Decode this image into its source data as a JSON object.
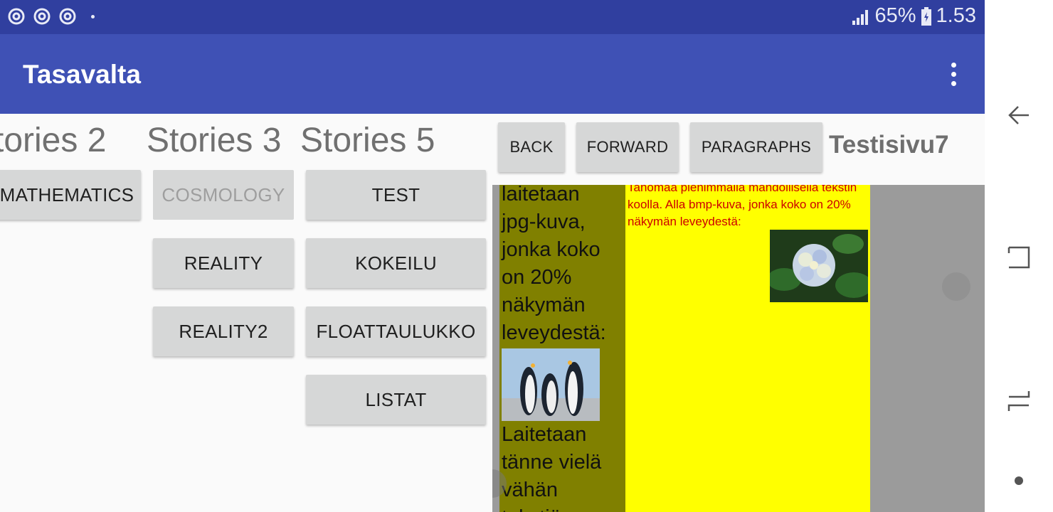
{
  "status_bar": {
    "battery": "65%",
    "time": "1.53",
    "icons": [
      "sync-icon",
      "sync-icon",
      "sync-icon",
      "dot-icon",
      "signal-icon",
      "battery-icon"
    ]
  },
  "app_bar": {
    "title": "Tasavalta",
    "menu_icon": "more-vert-icon"
  },
  "stories": {
    "titles": [
      "tories 2",
      "Stories 3",
      "Stories 5"
    ],
    "col1_buttons": [
      "MATHEMATICS"
    ],
    "col2_buttons": [
      "COSMOLOGY",
      "REALITY",
      "REALITY2"
    ],
    "col3_buttons": [
      "TEST",
      "KOKEILU",
      "FLOATTAULUKKO",
      "LISTAT"
    ]
  },
  "browser": {
    "back_label": "BACK",
    "forward_label": "FORWARD",
    "paragraphs_label": "PARAGRAPHS",
    "page_title": "Testisivu7"
  },
  "web_content": {
    "col1_lines_a": [
      "laitetaan",
      "jpg-kuva,",
      "jonka koko",
      "on 20%",
      "näkymän",
      "leveydestä:"
    ],
    "col1_lines_b": [
      "Laitetaan",
      "tänne vielä",
      "vähän",
      "tekstiä"
    ],
    "col2_text": "Tahomaa pienimmällä mahdollisella tekstin koolla. Alla bmp-kuva, jonka koko on 20% näkymän leveydestä:",
    "col1_image": "penguins-image",
    "col2_image": "hydrangea-image",
    "colors": {
      "col1_bg": "#808000",
      "col2_bg": "#ffff00",
      "col2_text": "#cc0000",
      "page_bg": "#9b9b9b"
    }
  },
  "nav_bar": {
    "icons": [
      "back-icon",
      "recents-icon",
      "overview-icon",
      "home-dot-icon"
    ]
  },
  "colors": {
    "status_bar": "#303f9f",
    "app_bar": "#3f51b5",
    "button": "#d6d7d7"
  }
}
